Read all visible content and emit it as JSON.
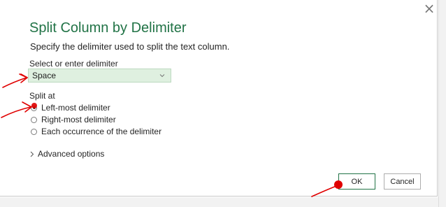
{
  "dialog": {
    "title": "Split Column by Delimiter",
    "subtitle": "Specify the delimiter used to split the text column.",
    "close_glyph": "×"
  },
  "delimiter": {
    "label": "Select or enter delimiter",
    "selected": "Space"
  },
  "split_at": {
    "label": "Split at",
    "options": [
      {
        "label": "Left-most delimiter",
        "checked": true
      },
      {
        "label": "Right-most delimiter",
        "checked": false
      },
      {
        "label": "Each occurrence of the delimiter",
        "checked": false
      }
    ]
  },
  "advanced": {
    "label": "Advanced options"
  },
  "buttons": {
    "ok": "OK",
    "cancel": "Cancel"
  },
  "colors": {
    "title": "#217346",
    "select_bg": "#dff0e0",
    "annotation": "#e00000"
  }
}
